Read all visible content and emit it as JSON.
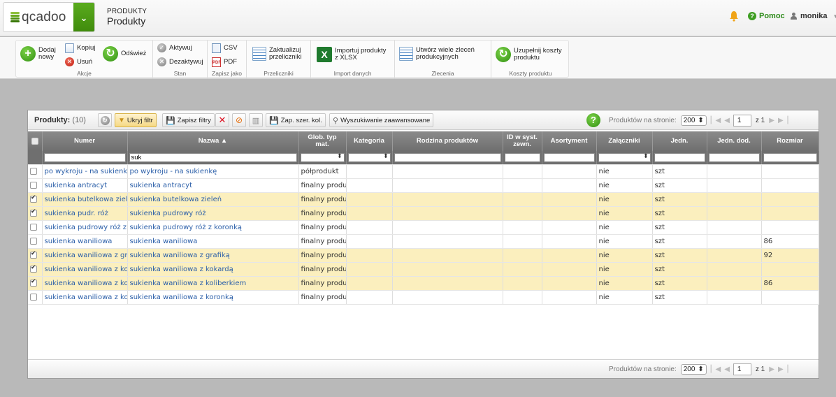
{
  "header": {
    "logo": "qcadoo",
    "category": "PRODUKTY",
    "title": "Produkty",
    "help_label": "Pomoc",
    "user": "monika"
  },
  "ribbon": {
    "groups": [
      {
        "label": "Akcje",
        "buttons": {
          "add": "Dodaj nowy",
          "copy": "Kopiuj",
          "delete": "Usuń",
          "refresh": "Odśwież"
        }
      },
      {
        "label": "Stan",
        "buttons": {
          "activate": "Aktywuj",
          "deactivate": "Dezaktywuj"
        }
      },
      {
        "label": "Zapisz jako",
        "buttons": {
          "csv": "CSV",
          "pdf": "PDF"
        }
      },
      {
        "label": "Przeliczniki",
        "buttons": {
          "update": "Zaktualizuj przeliczniki"
        }
      },
      {
        "label": "Import danych",
        "buttons": {
          "import": "Importuj produkty z XLSX"
        }
      },
      {
        "label": "Zlecenia",
        "buttons": {
          "create": "Utwórz wiele zleceń produkcyjnych"
        }
      },
      {
        "label": "Koszty produktu",
        "buttons": {
          "fill": "Uzupełnij koszty produktu"
        }
      }
    ]
  },
  "grid_panel": {
    "title": "Produkty:",
    "count": "(10)",
    "toolbar": {
      "hide_filter": "Ukryj filtr",
      "save_filters": "Zapisz filtry",
      "save_col_width": "Zap. szer. kol.",
      "advanced_search": "Wyszukiwanie zaawansowane"
    },
    "pager": {
      "per_page_label": "Produktów na stronie:",
      "per_page_value": "200",
      "page": "1",
      "of_label": "z 1"
    },
    "columns": [
      "Numer",
      "Nazwa",
      "Glob. typ mat.",
      "Kategoria",
      "Rodzina produktów",
      "ID w syst. zewn.",
      "Asortyment",
      "Załączniki",
      "Jedn.",
      "Jedn. dod.",
      "Rozmiar"
    ],
    "sort_indicator": "▲",
    "filters": {
      "nazwa": "suk"
    },
    "rows": [
      {
        "checked": false,
        "numer": "po wykroju - na sukienkę",
        "nazwa": "po wykroju - na sukienkę",
        "typ": "półprodukt",
        "zal": "nie",
        "jedn": "szt",
        "rozmiar": ""
      },
      {
        "checked": false,
        "numer": "sukienka antracyt",
        "nazwa": "sukienka antracyt",
        "typ": "finalny produkt",
        "zal": "nie",
        "jedn": "szt",
        "rozmiar": ""
      },
      {
        "checked": true,
        "numer": "sukienka butelkowa zieleń",
        "nazwa": "sukienka butelkowa zieleń",
        "typ": "finalny produkt",
        "zal": "nie",
        "jedn": "szt",
        "rozmiar": ""
      },
      {
        "checked": true,
        "numer": "sukienka pudr. róż",
        "nazwa": "sukienka pudrowy róż",
        "typ": "finalny produkt",
        "zal": "nie",
        "jedn": "szt",
        "rozmiar": ""
      },
      {
        "checked": false,
        "numer": "sukienka pudrowy róż z koronką",
        "nazwa": "sukienka pudrowy róż z koronką",
        "typ": "finalny produkt",
        "zal": "nie",
        "jedn": "szt",
        "rozmiar": ""
      },
      {
        "checked": false,
        "numer": "sukienka waniliowa",
        "nazwa": "sukienka waniliowa",
        "typ": "finalny produkt",
        "zal": "nie",
        "jedn": "szt",
        "rozmiar": "86"
      },
      {
        "checked": true,
        "numer": "sukienka waniliowa z grafiką",
        "nazwa": "sukienka waniliowa z grafiką",
        "typ": "finalny produkt",
        "zal": "nie",
        "jedn": "szt",
        "rozmiar": "92"
      },
      {
        "checked": true,
        "numer": "sukienka waniliowa z kokardą",
        "nazwa": "sukienka waniliowa z kokardą",
        "typ": "finalny produkt",
        "zal": "nie",
        "jedn": "szt",
        "rozmiar": ""
      },
      {
        "checked": true,
        "numer": "sukienka waniliowa z koliberkiem",
        "nazwa": "sukienka waniliowa z koliberkiem",
        "typ": "finalny produkt",
        "zal": "nie",
        "jedn": "szt",
        "rozmiar": "86"
      },
      {
        "checked": false,
        "numer": "sukienka waniliowa z koronką",
        "nazwa": "sukienka waniliowa z koronką",
        "typ": "finalny produkt",
        "zal": "nie",
        "jedn": "szt",
        "rozmiar": ""
      }
    ]
  },
  "colors": {
    "brand_green": "#3e8a0b",
    "selected_row": "#fbefbe",
    "link": "#2a5ea8",
    "header_gray": "#7a7a7a"
  }
}
